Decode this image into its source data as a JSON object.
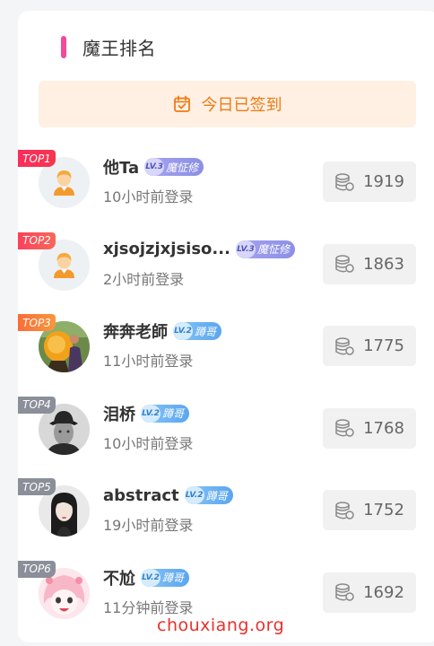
{
  "panel": {
    "title": "魔王排名",
    "accent_color": "#f14a9a"
  },
  "checkin": {
    "label": "今日已签到",
    "icon": "calendar-check-icon",
    "color": "#f07a13"
  },
  "ranking": [
    {
      "rank": "TOP1",
      "badge_color": "#f5364f",
      "name": "他Ta",
      "level": "LV.3",
      "level_title": "魔怔修",
      "login": "10小时前登录",
      "coins": "1919",
      "avatar": "default-avatar"
    },
    {
      "rank": "TOP2",
      "badge_color": "#f7595a",
      "name": "xjsojzjxjsiso...",
      "level": "LV.3",
      "level_title": "魔怔修",
      "login": "2小时前登录",
      "coins": "1863",
      "avatar": "default-avatar"
    },
    {
      "rank": "TOP3",
      "badge_color": "#f8873b",
      "name": "奔奔老師",
      "level": "LV.2",
      "level_title": "蹲哥",
      "login": "11小时前登录",
      "coins": "1775",
      "avatar": "photo-avatar"
    },
    {
      "rank": "TOP4",
      "badge_color": "#8a8f99",
      "name": "泪桥",
      "level": "LV.2",
      "level_title": "蹲哥",
      "login": "10小时前登录",
      "coins": "1768",
      "avatar": "photo-avatar"
    },
    {
      "rank": "TOP5",
      "badge_color": "#8a8f99",
      "name": "abstract",
      "level": "LV.2",
      "level_title": "蹲哥",
      "login": "19小时前登录",
      "coins": "1752",
      "avatar": "photo-avatar"
    },
    {
      "rank": "TOP6",
      "badge_color": "#8a8f99",
      "name": "不尬",
      "level": "LV.2",
      "level_title": "蹲哥",
      "login": "11分钟前登录",
      "coins": "1692",
      "avatar": "anime-avatar"
    }
  ],
  "coin_icon": "coin-stack-icon",
  "watermark": "chouxiang.org"
}
